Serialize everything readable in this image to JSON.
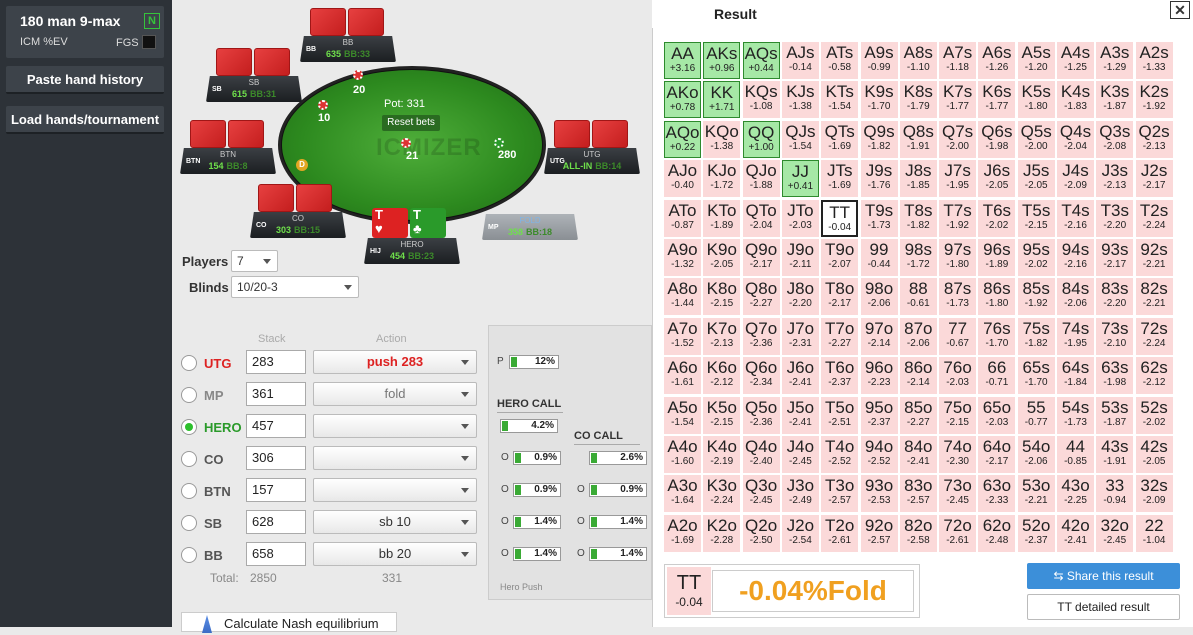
{
  "sidebar": {
    "title": "180 man 9-max",
    "badge": "N",
    "icm_label": "ICM %EV",
    "fgs_label": "FGS",
    "paste_btn": "Paste hand history",
    "load_btn": "Load hands/tournament"
  },
  "table": {
    "pot": "Pot: 331",
    "reset_bets": "Reset bets",
    "logo": "ICMIZER",
    "dealer": "D",
    "chips": {
      "bb": "20",
      "sb": "10",
      "utg": "21",
      "right": "280"
    },
    "seats": {
      "bb": {
        "pos": "BB",
        "name": "BB",
        "stack": "635",
        "bb": "BB:33"
      },
      "sb": {
        "pos": "SB",
        "name": "SB",
        "stack": "615",
        "bb": "BB:31"
      },
      "btn": {
        "pos": "BTN",
        "name": "BTN",
        "stack": "154",
        "bb": "BB:8"
      },
      "co": {
        "pos": "CO",
        "name": "CO",
        "stack": "303",
        "bb": "BB:15"
      },
      "hero": {
        "pos": "HIJ",
        "name": "HERO",
        "stack": "454",
        "bb": "BB:23"
      },
      "mp": {
        "pos": "MP",
        "name": "FOLD",
        "stack": "358",
        "bb": "BB:18"
      },
      "utg": {
        "pos": "UTG",
        "name": "UTG",
        "stack": "ALL-IN",
        "bb": "BB:14"
      }
    },
    "hero_cards": [
      {
        "rank": "T",
        "suit": "♥",
        "color": "#d22"
      },
      {
        "rank": "T",
        "suit": "♣",
        "color": "#2a9a2a"
      }
    ]
  },
  "controls": {
    "players_label": "Players",
    "players_value": "7",
    "blinds_label": "Blinds",
    "blinds_value": "10/20-3",
    "stack_header": "Stack",
    "action_header": "Action",
    "players": [
      {
        "pos": "UTG",
        "color": "#d22",
        "stack": "283",
        "action": "push 283",
        "action_color": "#d22",
        "selected": false
      },
      {
        "pos": "MP",
        "color": "#888",
        "stack": "361",
        "action": "fold",
        "action_color": "#777",
        "selected": false
      },
      {
        "pos": "HERO",
        "color": "#2a9a2a",
        "stack": "457",
        "action": "",
        "action_color": "#777",
        "selected": true
      },
      {
        "pos": "CO",
        "color": "#555",
        "stack": "306",
        "action": "",
        "action_color": "#777",
        "selected": false
      },
      {
        "pos": "BTN",
        "color": "#555",
        "stack": "157",
        "action": "",
        "action_color": "#777",
        "selected": false
      },
      {
        "pos": "SB",
        "color": "#555",
        "stack": "628",
        "action": "sb 10",
        "action_color": "#333",
        "selected": false
      },
      {
        "pos": "BB",
        "color": "#555",
        "stack": "658",
        "action": "bb 20",
        "action_color": "#333",
        "selected": false
      }
    ],
    "total_label": "Total:",
    "total_stack": "2850",
    "total_action": "331",
    "calc_btn": "Calculate Nash equilibrium"
  },
  "ranges": {
    "p_label": "P",
    "p_value": "12%",
    "hero_call_title": "HERO CALL",
    "hero_call_value": "4.2%",
    "co_call_title": "CO CALL",
    "hero_rows": [
      {
        "l": "O",
        "v": "0.9%"
      },
      {
        "l": "O",
        "v": "0.9%"
      },
      {
        "l": "O",
        "v": "1.4%"
      },
      {
        "l": "O",
        "v": "1.4%"
      }
    ],
    "co_rows": [
      {
        "l": "",
        "v": "2.6%"
      },
      {
        "l": "O",
        "v": "0.9%"
      },
      {
        "l": "O",
        "v": "1.4%"
      },
      {
        "l": "O",
        "v": "1.4%"
      }
    ],
    "tab_label": "Hero Push"
  },
  "result": {
    "title": "Result",
    "close": "✕",
    "grid": [
      [
        [
          "AA",
          "+3.16"
        ],
        [
          "AKs",
          "+0.96"
        ],
        [
          "AQs",
          "+0.44"
        ],
        [
          "AJs",
          "-0.14"
        ],
        [
          "ATs",
          "-0.58"
        ],
        [
          "A9s",
          "-0.99"
        ],
        [
          "A8s",
          "-1.10"
        ],
        [
          "A7s",
          "-1.18"
        ],
        [
          "A6s",
          "-1.26"
        ],
        [
          "A5s",
          "-1.20"
        ],
        [
          "A4s",
          "-1.25"
        ],
        [
          "A3s",
          "-1.29"
        ],
        [
          "A2s",
          "-1.33"
        ]
      ],
      [
        [
          "AKo",
          "+0.78"
        ],
        [
          "KK",
          "+1.71"
        ],
        [
          "KQs",
          "-1.08"
        ],
        [
          "KJs",
          "-1.38"
        ],
        [
          "KTs",
          "-1.54"
        ],
        [
          "K9s",
          "-1.70"
        ],
        [
          "K8s",
          "-1.79"
        ],
        [
          "K7s",
          "-1.77"
        ],
        [
          "K6s",
          "-1.77"
        ],
        [
          "K5s",
          "-1.80"
        ],
        [
          "K4s",
          "-1.83"
        ],
        [
          "K3s",
          "-1.87"
        ],
        [
          "K2s",
          "-1.92"
        ]
      ],
      [
        [
          "AQo",
          "+0.22"
        ],
        [
          "KQo",
          "-1.38"
        ],
        [
          "QQ",
          "+1.00"
        ],
        [
          "QJs",
          "-1.54"
        ],
        [
          "QTs",
          "-1.69"
        ],
        [
          "Q9s",
          "-1.82"
        ],
        [
          "Q8s",
          "-1.91"
        ],
        [
          "Q7s",
          "-2.00"
        ],
        [
          "Q6s",
          "-1.98"
        ],
        [
          "Q5s",
          "-2.00"
        ],
        [
          "Q4s",
          "-2.04"
        ],
        [
          "Q3s",
          "-2.08"
        ],
        [
          "Q2s",
          "-2.13"
        ]
      ],
      [
        [
          "AJo",
          "-0.40"
        ],
        [
          "KJo",
          "-1.72"
        ],
        [
          "QJo",
          "-1.88"
        ],
        [
          "JJ",
          "+0.41"
        ],
        [
          "JTs",
          "-1.69"
        ],
        [
          "J9s",
          "-1.76"
        ],
        [
          "J8s",
          "-1.85"
        ],
        [
          "J7s",
          "-1.95"
        ],
        [
          "J6s",
          "-2.05"
        ],
        [
          "J5s",
          "-2.05"
        ],
        [
          "J4s",
          "-2.09"
        ],
        [
          "J3s",
          "-2.13"
        ],
        [
          "J2s",
          "-2.17"
        ]
      ],
      [
        [
          "ATo",
          "-0.87"
        ],
        [
          "KTo",
          "-1.89"
        ],
        [
          "QTo",
          "-2.04"
        ],
        [
          "JTo",
          "-2.03"
        ],
        [
          "TT",
          "-0.04"
        ],
        [
          "T9s",
          "-1.73"
        ],
        [
          "T8s",
          "-1.82"
        ],
        [
          "T7s",
          "-1.92"
        ],
        [
          "T6s",
          "-2.02"
        ],
        [
          "T5s",
          "-2.15"
        ],
        [
          "T4s",
          "-2.16"
        ],
        [
          "T3s",
          "-2.20"
        ],
        [
          "T2s",
          "-2.24"
        ]
      ],
      [
        [
          "A9o",
          "-1.32"
        ],
        [
          "K9o",
          "-2.05"
        ],
        [
          "Q9o",
          "-2.17"
        ],
        [
          "J9o",
          "-2.11"
        ],
        [
          "T9o",
          "-2.07"
        ],
        [
          "99",
          "-0.44"
        ],
        [
          "98s",
          "-1.72"
        ],
        [
          "97s",
          "-1.80"
        ],
        [
          "96s",
          "-1.89"
        ],
        [
          "95s",
          "-2.02"
        ],
        [
          "94s",
          "-2.16"
        ],
        [
          "93s",
          "-2.17"
        ],
        [
          "92s",
          "-2.21"
        ]
      ],
      [
        [
          "A8o",
          "-1.44"
        ],
        [
          "K8o",
          "-2.15"
        ],
        [
          "Q8o",
          "-2.27"
        ],
        [
          "J8o",
          "-2.20"
        ],
        [
          "T8o",
          "-2.17"
        ],
        [
          "98o",
          "-2.06"
        ],
        [
          "88",
          "-0.61"
        ],
        [
          "87s",
          "-1.73"
        ],
        [
          "86s",
          "-1.80"
        ],
        [
          "85s",
          "-1.92"
        ],
        [
          "84s",
          "-2.06"
        ],
        [
          "83s",
          "-2.20"
        ],
        [
          "82s",
          "-2.21"
        ]
      ],
      [
        [
          "A7o",
          "-1.52"
        ],
        [
          "K7o",
          "-2.13"
        ],
        [
          "Q7o",
          "-2.36"
        ],
        [
          "J7o",
          "-2.31"
        ],
        [
          "T7o",
          "-2.27"
        ],
        [
          "97o",
          "-2.14"
        ],
        [
          "87o",
          "-2.06"
        ],
        [
          "77",
          "-0.67"
        ],
        [
          "76s",
          "-1.70"
        ],
        [
          "75s",
          "-1.82"
        ],
        [
          "74s",
          "-1.95"
        ],
        [
          "73s",
          "-2.10"
        ],
        [
          "72s",
          "-2.24"
        ]
      ],
      [
        [
          "A6o",
          "-1.61"
        ],
        [
          "K6o",
          "-2.12"
        ],
        [
          "Q6o",
          "-2.34"
        ],
        [
          "J6o",
          "-2.41"
        ],
        [
          "T6o",
          "-2.37"
        ],
        [
          "96o",
          "-2.23"
        ],
        [
          "86o",
          "-2.14"
        ],
        [
          "76o",
          "-2.03"
        ],
        [
          "66",
          "-0.71"
        ],
        [
          "65s",
          "-1.70"
        ],
        [
          "64s",
          "-1.84"
        ],
        [
          "63s",
          "-1.98"
        ],
        [
          "62s",
          "-2.12"
        ]
      ],
      [
        [
          "A5o",
          "-1.54"
        ],
        [
          "K5o",
          "-2.15"
        ],
        [
          "Q5o",
          "-2.36"
        ],
        [
          "J5o",
          "-2.41"
        ],
        [
          "T5o",
          "-2.51"
        ],
        [
          "95o",
          "-2.37"
        ],
        [
          "85o",
          "-2.27"
        ],
        [
          "75o",
          "-2.15"
        ],
        [
          "65o",
          "-2.03"
        ],
        [
          "55",
          "-0.77"
        ],
        [
          "54s",
          "-1.73"
        ],
        [
          "53s",
          "-1.87"
        ],
        [
          "52s",
          "-2.02"
        ]
      ],
      [
        [
          "A4o",
          "-1.60"
        ],
        [
          "K4o",
          "-2.19"
        ],
        [
          "Q4o",
          "-2.40"
        ],
        [
          "J4o",
          "-2.45"
        ],
        [
          "T4o",
          "-2.52"
        ],
        [
          "94o",
          "-2.52"
        ],
        [
          "84o",
          "-2.41"
        ],
        [
          "74o",
          "-2.30"
        ],
        [
          "64o",
          "-2.17"
        ],
        [
          "54o",
          "-2.06"
        ],
        [
          "44",
          "-0.85"
        ],
        [
          "43s",
          "-1.91"
        ],
        [
          "42s",
          "-2.05"
        ]
      ],
      [
        [
          "A3o",
          "-1.64"
        ],
        [
          "K3o",
          "-2.24"
        ],
        [
          "Q3o",
          "-2.45"
        ],
        [
          "J3o",
          "-2.49"
        ],
        [
          "T3o",
          "-2.57"
        ],
        [
          "93o",
          "-2.53"
        ],
        [
          "83o",
          "-2.57"
        ],
        [
          "73o",
          "-2.45"
        ],
        [
          "63o",
          "-2.33"
        ],
        [
          "53o",
          "-2.21"
        ],
        [
          "43o",
          "-2.25"
        ],
        [
          "33",
          "-0.94"
        ],
        [
          "32s",
          "-2.09"
        ]
      ],
      [
        [
          "A2o",
          "-1.69"
        ],
        [
          "K2o",
          "-2.28"
        ],
        [
          "Q2o",
          "-2.50"
        ],
        [
          "J2o",
          "-2.54"
        ],
        [
          "T2o",
          "-2.61"
        ],
        [
          "92o",
          "-2.57"
        ],
        [
          "82o",
          "-2.58"
        ],
        [
          "72o",
          "-2.61"
        ],
        [
          "62o",
          "-2.48"
        ],
        [
          "52o",
          "-2.37"
        ],
        [
          "42o",
          "-2.41"
        ],
        [
          "32o",
          "-2.45"
        ],
        [
          "22",
          "-1.04"
        ]
      ]
    ],
    "selected_hand": "TT",
    "selected_value": "-0.04",
    "big_result": "-0.04%Fold",
    "share_btn": "Share this result",
    "detail_btn": "TT detailed result"
  }
}
